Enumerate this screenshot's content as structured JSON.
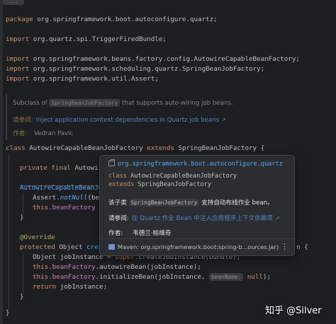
{
  "code": {
    "fold_marker": "...",
    "package_kw": "package",
    "package_name": " org.springframework.boot.autoconfigure.quartz;",
    "imports": [
      "org.quartz.spi.TriggerFiredBundle;",
      "org.springframework.beans.factory.config.AutowireCapableBeanFactory;",
      "org.springframework.scheduling.quartz.SpringBeanJobFactory;",
      "org.springframework.util.Assert;"
    ],
    "import_kw": "import",
    "class_kw": "class",
    "class_name": " AutowireCapableBeanJobFactory ",
    "extends_kw": "extends",
    "super_name": " SpringBeanJobFactory {",
    "field_line": {
      "kw": "private final",
      "rest": " Autowire"
    },
    "ctor_name": "AutowireCapableBeanJob",
    "assert_line": {
      "cls": "Assert.",
      "meth": "notNull",
      "rest": "(bea"
    },
    "this_line": {
      "kw": "this",
      "field": ".beanFactory",
      "rest": " ="
    },
    "close_brace_1": "}",
    "override": "@Override",
    "protected_kw": "protected",
    "create_type": " Object ",
    "create_name": "creat",
    "create_tail": "n {",
    "obj_line": {
      "type": "Object jobInstance = ",
      "super_kw": "super",
      "rest": ".createJobInstance(bundle);"
    },
    "autowire_line": {
      "kw": "this",
      "field": ".beanFactory",
      "rest": ".autowireBean(jobInstance);"
    },
    "init_line": {
      "kw": "this",
      "field": ".beanFactory",
      "rest": ".initializeBean(jobInstance, ",
      "hint": "beanName:",
      "null_kw": "null",
      "end": ");"
    },
    "return_line": {
      "kw": "return",
      "rest": " jobInstance;"
    },
    "close_brace_2": "}",
    "close_brace_3": "}"
  },
  "javadoc": {
    "subclass_of": "Subclass of ",
    "subclass_code": "SpringBeanJobFactory",
    "subclass_tail": " that supports auto-wiring job beans.",
    "see_label": "请参阅:",
    "see_link": "Inject application context dependencies in Quartz job beans",
    "author_label": "作者:",
    "author_name": "Vedran Pavic"
  },
  "popup": {
    "package": "org.springframework.boot.autoconfigure.quartz",
    "class_kw": "class",
    "class_name": " AutowireCapableBeanJobFactory",
    "extends_kw": "extends",
    "extends_name": " SpringBeanJobFactory",
    "desc_prefix": "该子类",
    "desc_code": "SpringBeanJobFactory",
    "desc_suffix": " 支持自动布线作业 bean。",
    "see_label": "请参阅:",
    "see_link": "在 Quartz 作业 Bean 中注入应用程序上下文依赖项",
    "author_label": "作者:",
    "author_name": "韦德兰·帕维奇",
    "maven": "Maven: org.springframework.boot:spring-b...ources.jar)",
    "more": "⋮"
  },
  "watermark": "知乎 @Silver"
}
